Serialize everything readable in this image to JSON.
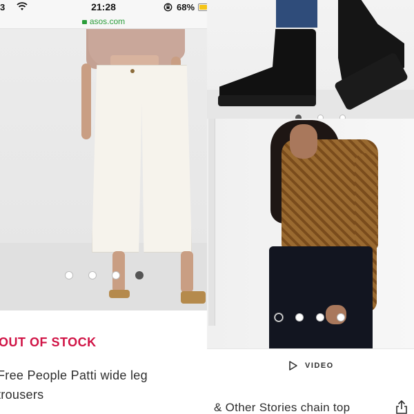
{
  "status_bar": {
    "carrier_signal": "3",
    "time": "21:28",
    "battery_percent": "68%",
    "battery_level": 0.68,
    "battery_color": "#f5c518"
  },
  "url_bar": {
    "url": "asos.com",
    "secure_color": "#2a9d3a"
  },
  "left_product": {
    "image_name": "white wide leg trousers product photo",
    "carousel": {
      "count": 4,
      "active_index": 3
    },
    "stock_status": "OUT OF STOCK",
    "stock_status_color": "#d01345",
    "name_line1": "Free People Patti wide leg",
    "name_line2": "trousers"
  },
  "right_products": {
    "top_image_name": "black chunky sock boots product photo",
    "top_carousel": {
      "count": 3,
      "active_index": 0
    },
    "main_image_name": "& Other Stories chain top product photo",
    "main_carousel": {
      "count": 4,
      "active_index": 0
    },
    "video_label": "VIDEO",
    "name": "& Other Stories chain top"
  },
  "icons": [
    "wifi-icon",
    "rotation-lock-icon",
    "battery-icon",
    "lock-icon",
    "play-icon",
    "share-icon"
  ]
}
